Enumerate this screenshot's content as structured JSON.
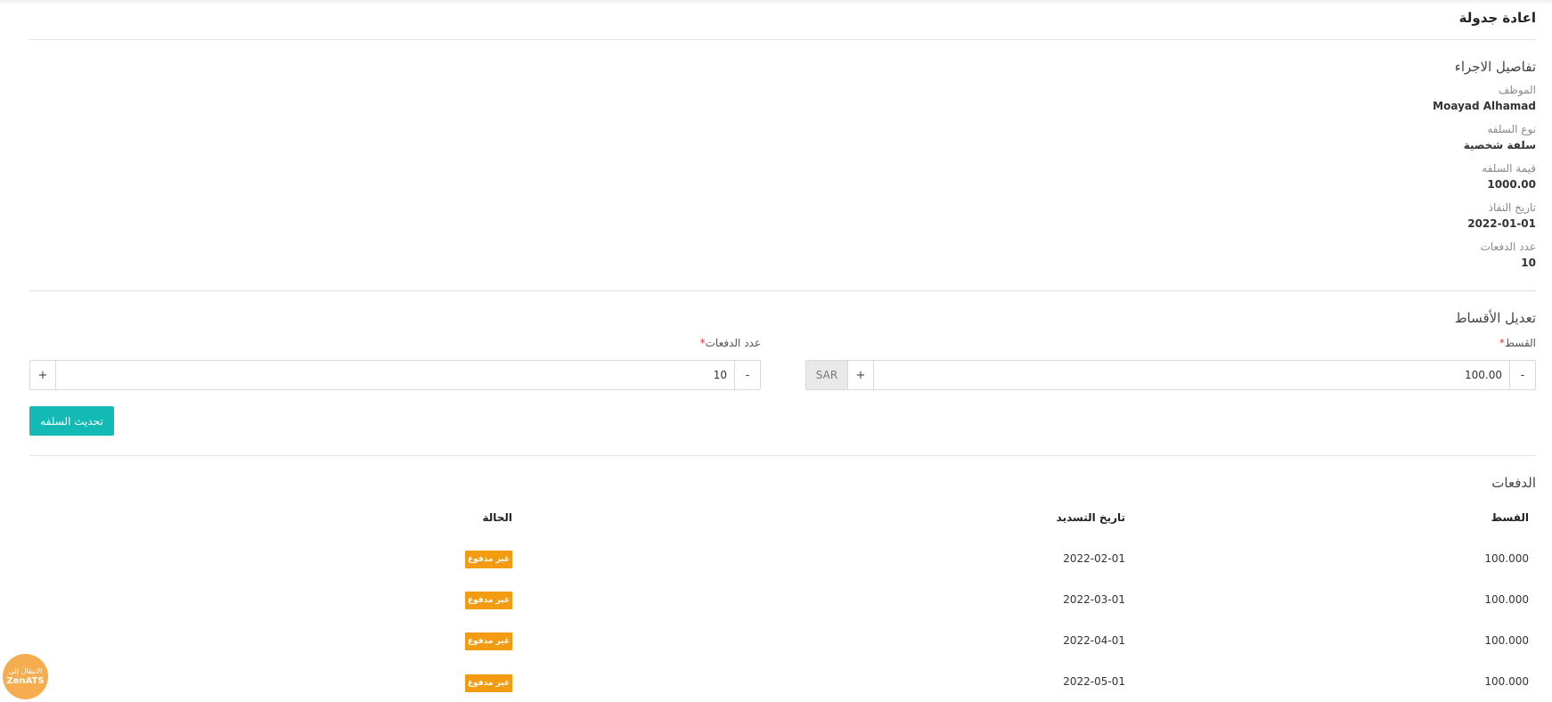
{
  "page": {
    "title": "اعادة جدولة"
  },
  "details": {
    "section_title": "تفاصيل الاجراء",
    "fields": [
      {
        "label": "الموظف",
        "value": "Moayad Alhamad"
      },
      {
        "label": "نوع السلفه",
        "value": "سلفة شخصية"
      },
      {
        "label": "قيمة السلفه",
        "value": "1000.00"
      },
      {
        "label": "تاريخ النفاذ",
        "value": "2022-01-01"
      },
      {
        "label": "عدد الدفعات",
        "value": "10"
      }
    ]
  },
  "installments_edit": {
    "section_title": "تعديل الأقساط",
    "installment": {
      "label": "القسط",
      "required_mark": "*",
      "value": "100.00",
      "currency": "SAR",
      "minus": "-",
      "plus": "+"
    },
    "payments_count": {
      "label": "عدد الدفعات",
      "required_mark": "*",
      "value": "10",
      "minus": "-",
      "plus": "+"
    },
    "update_button": "تحديث السلفه"
  },
  "payments": {
    "section_title": "الدفعات",
    "columns": {
      "installment": "القسط",
      "due_date": "تاريخ التسديد",
      "status": "الحالة"
    },
    "rows": [
      {
        "installment": "100.000",
        "due_date": "2022-02-01",
        "status": "غير مدفوع"
      },
      {
        "installment": "100.000",
        "due_date": "2022-03-01",
        "status": "غير مدفوع"
      },
      {
        "installment": "100.000",
        "due_date": "2022-04-01",
        "status": "غير مدفوع"
      },
      {
        "installment": "100.000",
        "due_date": "2022-05-01",
        "status": "غير مدفوع"
      }
    ]
  },
  "switch_app": {
    "line1": "الانتقال إلى",
    "line2": "ZenATS"
  },
  "colors": {
    "primary": "#13b9b5",
    "badge_unpaid": "#f39c12",
    "floating": "#f6ad4f"
  }
}
